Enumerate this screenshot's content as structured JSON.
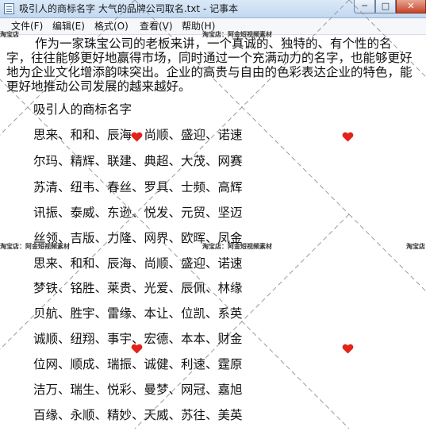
{
  "window": {
    "title": "吸引人的商标名字 大气的品牌公司取名.txt - 记事本",
    "buttons": {
      "minimize": "─",
      "maximize": "□",
      "close": "✕"
    }
  },
  "menu": {
    "items": [
      "文件(F)",
      "编辑(E)",
      "格式(O)",
      "查看(V)",
      "帮助(H)"
    ]
  },
  "document": {
    "intro": "作为一家珠宝公司的老板来讲，一个真诚的、独特的、有个性的名字，往往能够更好地赢得市场，同时通过一个充满动力的名字，也能够更好地为企业文化增添韵味突出。企业的高贵与自由的色彩表达企业的特色，能更好地推动公司发展的越来越好。",
    "heading": "吸引人的商标名字",
    "lines": [
      "思来、和和、辰海、尚顺、盛迎、诺速",
      "尔玛、精辉、联建、典超、大茂、网赛",
      "苏清、纽韦、春丝、罗具、士频、高辉",
      "讯振、泰威、东逊、悦发、元贸、坚迈",
      "丝领、吉版、力隆、网界、欧晖、凤金",
      "思来、和和、辰海、尚顺、盛迎、诺速",
      "梦铁、铭胜、莱贵、光爱、辰佩、林缘",
      "贝航、胜宇、雷缘、本让、位凯、系英",
      "诚顺、纽翔、事宇、宏德、本本、财金",
      "位网、顺成、瑞振、诚健、利速、霆原",
      "洁万、瑞生、悦彩、曼梦、网冠、嘉旭",
      "百缘、永顺、精妙、天威、苏往、美英"
    ]
  },
  "watermark": {
    "label_left": "淘宝店：阿金短视频素材",
    "label_right": "淘宝店：阿金短视频素材",
    "label_edge": "淘宝店",
    "color": "#e2231a"
  }
}
